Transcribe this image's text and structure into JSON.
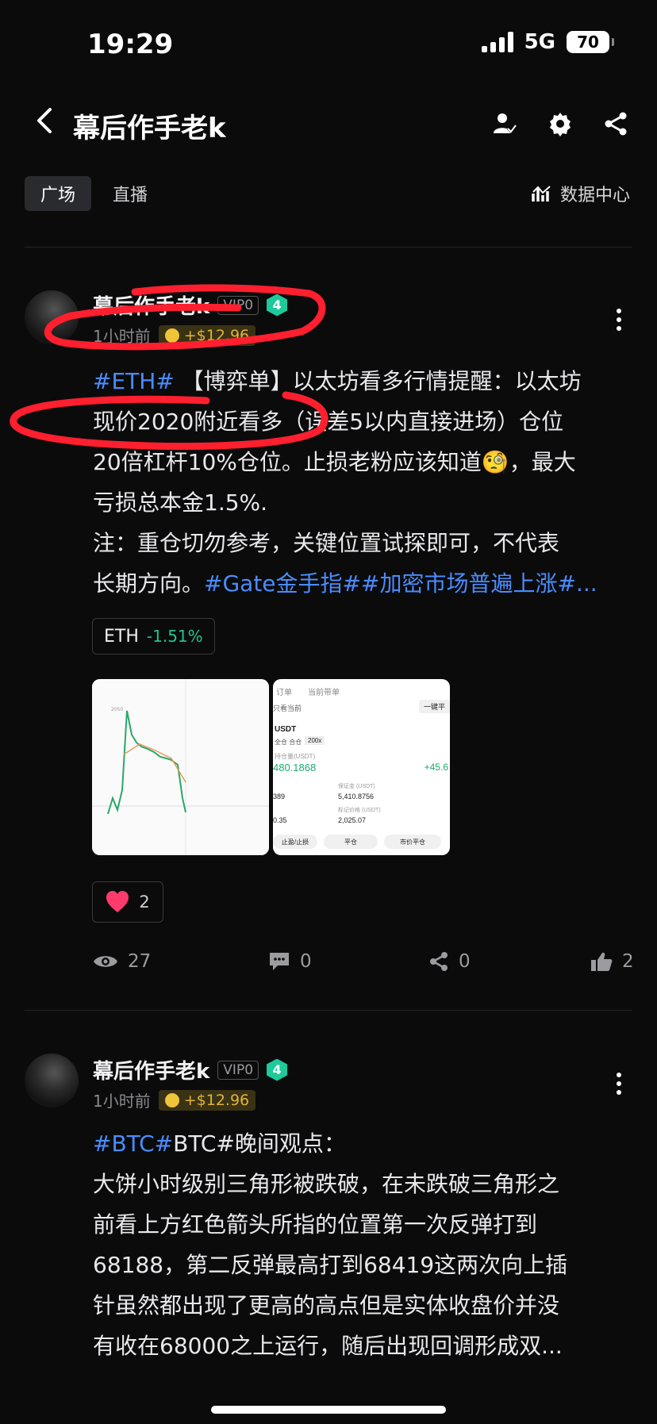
{
  "status_bar": {
    "time": "19:29",
    "network": "5G",
    "battery": "70"
  },
  "header": {
    "title": "幕后作手老k",
    "icons": [
      "back-arrow-icon",
      "user-follow-icon",
      "gear-icon",
      "share-icon"
    ]
  },
  "tabs": [
    {
      "label": "广场",
      "active": true
    },
    {
      "label": "直播",
      "active": false
    }
  ],
  "data_center": {
    "label": "数据中心",
    "icon": "chart-icon"
  },
  "posts": [
    {
      "author": "幕后作手老k",
      "vip": "VIP0",
      "level": "4",
      "time": "1小时前",
      "reward": "+$12.96",
      "lines": [
        {
          "tag": "#ETH#",
          "text": " 【博弈单】以太坊看多行情提醒：以太坊"
        },
        {
          "tag": "",
          "text": "现价2020附近看多（误差5以内直接进场）仓位"
        },
        {
          "tag": "",
          "text": "20倍杠杆10%仓位。止损老粉应该知道🧐，最大"
        },
        {
          "tag": "",
          "text": "亏损总本金1.5%."
        },
        {
          "tag": "",
          "text": "注：重仓切勿参考，关键位置试探即可，不代表"
        },
        {
          "tag": "",
          "text": "长期方向。",
          "tail": "#Gate金手指##加密市场普遍上涨#..."
        }
      ],
      "coin_chip": {
        "symbol": "ETH",
        "change": "-1.51%"
      },
      "screenshot_right": {
        "tabs": [
          "订单",
          "当前带单"
        ],
        "filter": "只看当前",
        "close_all": "一键平",
        "pair": "USDT",
        "mode": "全仓 合仓",
        "leverage": "200x",
        "qty_label": "持仓量(USDT)",
        "qty": "480.1868",
        "pnl": "+45.6",
        "margin_label": "保证金 (USDT)",
        "margin": "5,410.8756",
        "mark_label": "标记价格 (USDT)",
        "mark": "2,025.07",
        "left_vals": [
          "389",
          "0.35"
        ],
        "buttons": [
          "止盈/止损",
          "平仓",
          "市价平仓"
        ]
      },
      "likes": "2",
      "stats": {
        "views": "27",
        "comments": "0",
        "shares": "0",
        "thumbs": "2"
      }
    },
    {
      "author": "幕后作手老k",
      "vip": "VIP0",
      "level": "4",
      "time": "1小时前",
      "reward": "+$12.96",
      "lines": [
        {
          "tag": "#BTC#",
          "text": "BTC#晚间观点："
        },
        {
          "tag": "",
          "text": "大饼小时级别三角形被跌破，在未跌破三角形之"
        },
        {
          "tag": "",
          "text": "前看上方红色箭头所指的位置第一次反弹打到"
        },
        {
          "tag": "",
          "text": "68188，第二反弹最高打到68419这两次向上插"
        },
        {
          "tag": "",
          "text": "针虽然都出现了更高的高点但是实体收盘价并没"
        },
        {
          "tag": "",
          "text": "有收在68000之上运行，随后出现回调形成双..."
        }
      ]
    }
  ]
}
